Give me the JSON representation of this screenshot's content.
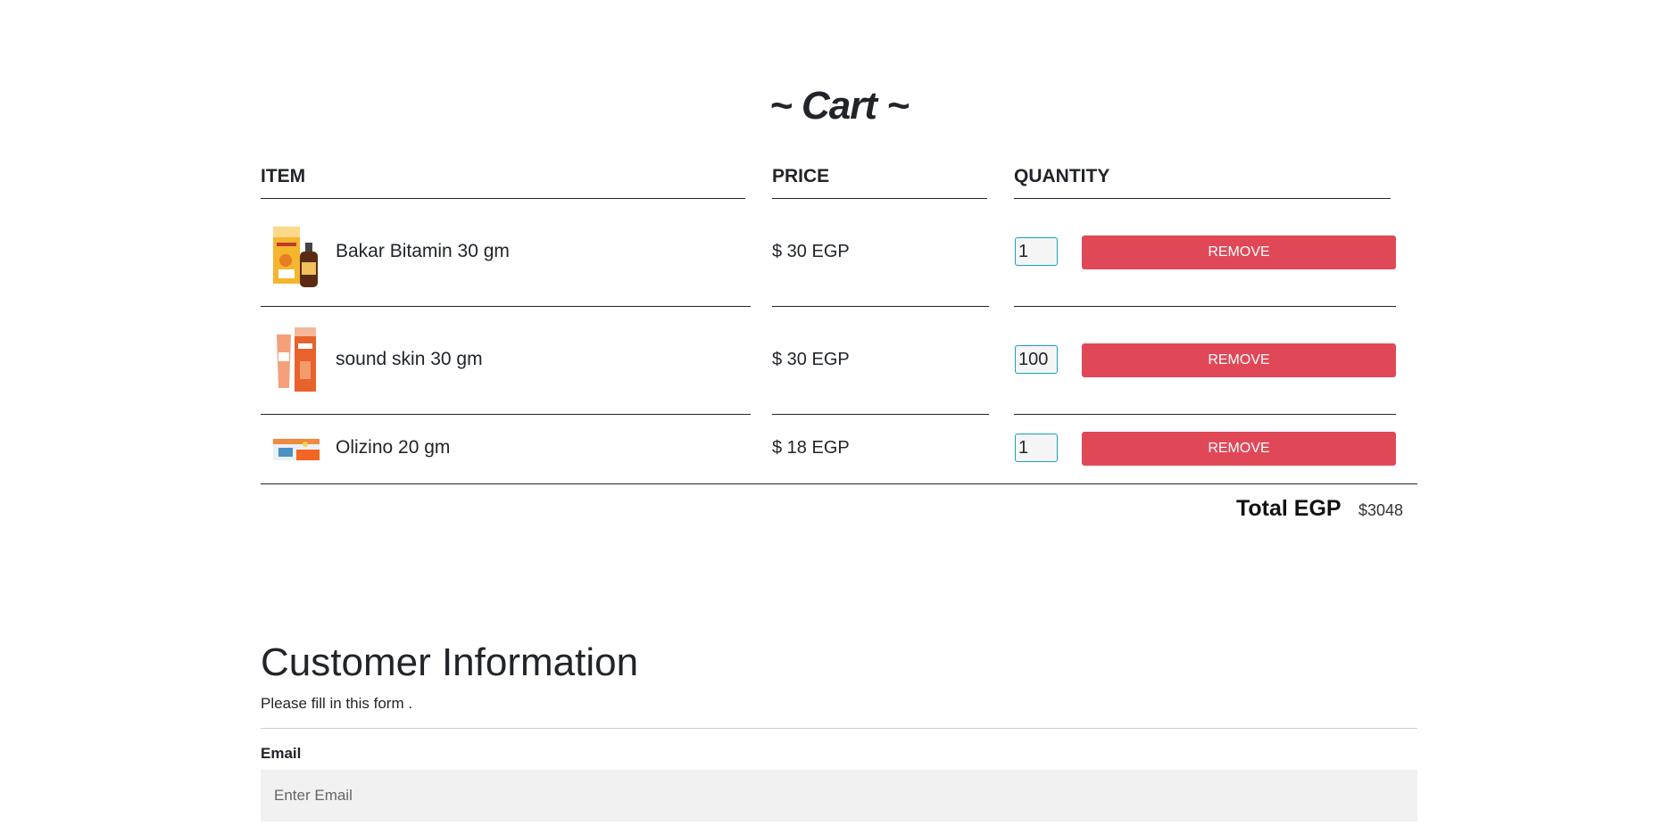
{
  "cart": {
    "title": "~ Cart ~",
    "headers": {
      "item": "ITEM",
      "price": "PRICE",
      "quantity": "QUANTITY"
    },
    "items": [
      {
        "name": "Bakar Bitamin 30 gm",
        "price": "$ 30 EGP",
        "quantity": "1",
        "remove_label": "REMOVE",
        "image_icon": "syrup-box-bottle-icon"
      },
      {
        "name": "sound skin 30 gm",
        "price": "$ 30 EGP",
        "quantity": "100",
        "remove_label": "REMOVE",
        "image_icon": "cream-tube-box-icon"
      },
      {
        "name": "Olizino 20 gm",
        "price": "$ 18 EGP",
        "quantity": "1",
        "remove_label": "REMOVE",
        "image_icon": "ointment-box-icon"
      }
    ],
    "total_label": "Total EGP",
    "total_value": "$3048"
  },
  "customer": {
    "title": "Customer Information",
    "subtitle": "Please fill in this form .",
    "email_label": "Email",
    "email_placeholder": "Enter Email",
    "email_value": ""
  },
  "colors": {
    "remove_button": "#e04858",
    "qty_border": "#17a2b8",
    "text": "#212529"
  }
}
